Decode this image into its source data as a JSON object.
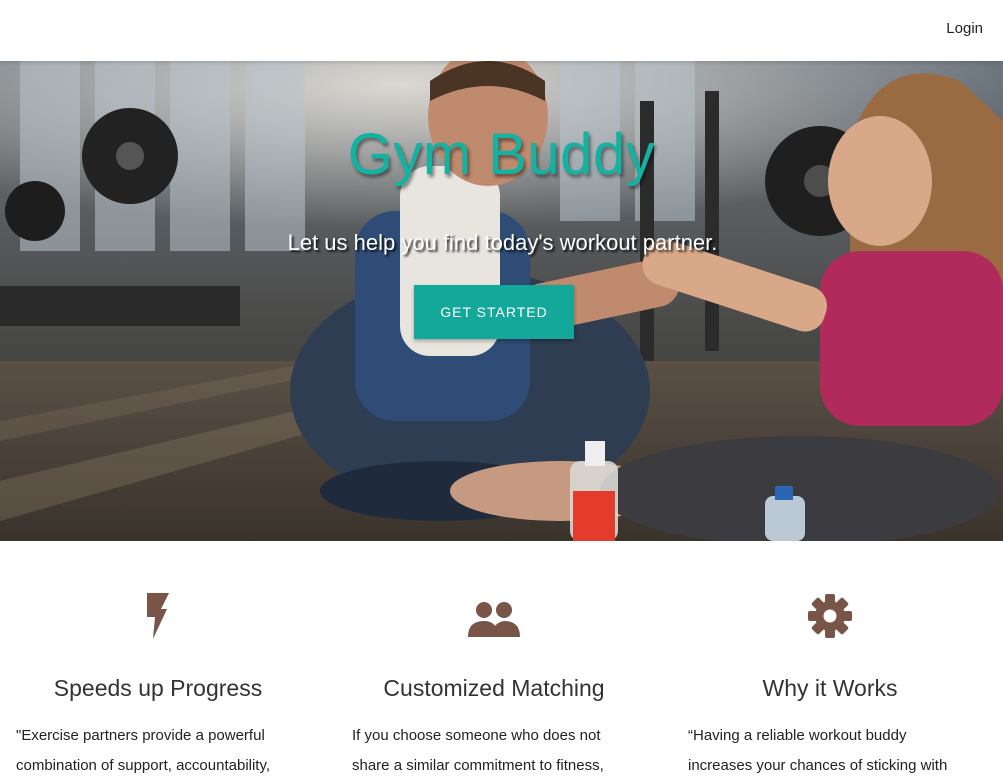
{
  "nav": {
    "login_label": "Login"
  },
  "hero": {
    "title": "Gym Buddy",
    "subtitle": "Let us help you find today's workout partner.",
    "cta_label": "GET STARTED"
  },
  "features": [
    {
      "icon": "lightning-bolt-icon",
      "title": "Speeds up Progress",
      "text": "\"Exercise partners provide a powerful combination of support, accountability,"
    },
    {
      "icon": "people-icon",
      "title": "Customized Matching",
      "text": "If you choose someone who does not share a similar commitment to fitness,"
    },
    {
      "icon": "gear-icon",
      "title": "Why it Works",
      "text": "“Having a reliable workout buddy increases your chances of sticking with"
    }
  ],
  "colors": {
    "accent": "#14a89a",
    "title": "#14b3a1",
    "icon": "#795548"
  }
}
